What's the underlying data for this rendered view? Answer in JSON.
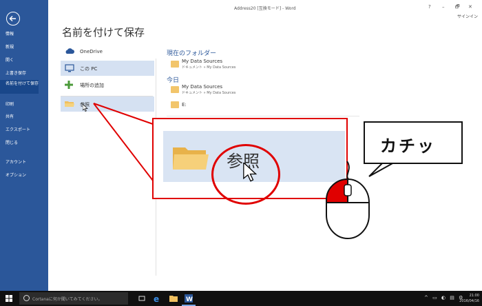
{
  "window": {
    "title": "Address20 [互換モード] - Word",
    "controls": [
      "?",
      "–",
      "🗗",
      "✕"
    ],
    "signin": "サインイン"
  },
  "nav": {
    "items": [
      {
        "label": "情報"
      },
      {
        "label": "新規"
      },
      {
        "label": "開く"
      },
      {
        "label": "上書き保存"
      },
      {
        "label": "名前を付けて保存"
      },
      {
        "label": "印刷"
      },
      {
        "label": "共有"
      },
      {
        "label": "エクスポート"
      },
      {
        "label": "閉じる"
      },
      {
        "label": "アカウント"
      },
      {
        "label": "オプション"
      }
    ],
    "active_index": 4
  },
  "page": {
    "title": "名前を付けて保存"
  },
  "places": {
    "onedrive": "OneDrive",
    "this_pc": "この PC",
    "add_place": "場所の追加",
    "browse": "参照"
  },
  "recent": {
    "current_folder_header": "現在のフォルダー",
    "today_header": "今日",
    "current_folder": {
      "name": "My Data Sources",
      "path": "ドキュメント » My Data Sources"
    },
    "today_items": [
      {
        "name": "My Data Sources",
        "path": "ドキュメント » My Data Sources"
      },
      {
        "name": "E:",
        "path": ""
      }
    ]
  },
  "callout": {
    "zoom_label": "参照",
    "bubble_text": "カチッ"
  },
  "taskbar": {
    "search_placeholder": "Cortanaに何か聞いてみてください。",
    "time": "21:00",
    "date": "2016/04/16"
  },
  "colors": {
    "word_blue": "#2b579a",
    "highlight": "#e00000",
    "selected_place": "#d5e1f2"
  }
}
